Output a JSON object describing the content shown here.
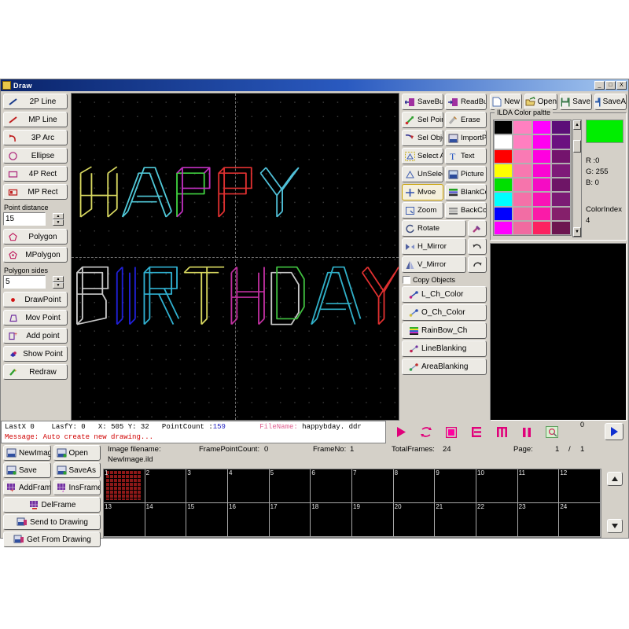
{
  "window": {
    "title": "Draw",
    "icon": "app-icon",
    "minimize": "_",
    "maximize": "□",
    "close": "X"
  },
  "left_tools": {
    "draw_tools": [
      {
        "label": "2P Line",
        "icon": "line-icon"
      },
      {
        "label": "MP Line",
        "icon": "polyline-icon"
      },
      {
        "label": "3P Arc",
        "icon": "arc-icon"
      },
      {
        "label": "Ellipse",
        "icon": "ellipse-icon"
      },
      {
        "label": "4P Rect",
        "icon": "rect-icon"
      },
      {
        "label": "MP Rect",
        "icon": "multi-rect-icon"
      }
    ],
    "point_distance": {
      "label": "Point distance",
      "value": "15"
    },
    "polygon_tools": [
      {
        "label": "Polygon",
        "icon": "polygon-icon"
      },
      {
        "label": "MPolygon",
        "icon": "multi-polygon-icon"
      }
    ],
    "polygon_sides": {
      "label": "Polygon sides",
      "value": "5"
    },
    "point_tools": [
      {
        "label": "DrawPoint",
        "icon": "draw-point-icon"
      },
      {
        "label": "Mov Point",
        "icon": "move-point-icon"
      },
      {
        "label": "Add point",
        "icon": "add-point-icon"
      },
      {
        "label": "Show Point",
        "icon": "show-point-icon"
      },
      {
        "label": "Redraw",
        "icon": "redraw-icon"
      }
    ]
  },
  "operations": {
    "rows": [
      [
        {
          "label": "Sel Point",
          "icon": "select-point-icon"
        },
        {
          "label": "Erase",
          "icon": "eraser-icon"
        }
      ],
      [
        {
          "label": "Sel Object",
          "icon": "select-object-icon"
        },
        {
          "label": "ImportPLT",
          "icon": "import-plt-icon"
        }
      ],
      [
        {
          "label": "Select All",
          "icon": "select-all-icon"
        },
        {
          "label": "Text",
          "icon": "text-icon"
        }
      ],
      [
        {
          "label": "UnSelect",
          "icon": "unselect-icon"
        },
        {
          "label": "Picture",
          "icon": "picture-icon"
        }
      ],
      [
        {
          "label": "Mvoe",
          "icon": "move-icon",
          "selected": true
        },
        {
          "label": "BlankColor",
          "icon": "blank-color-icon"
        }
      ],
      [
        {
          "label": "Zoom",
          "icon": "zoom-icon"
        },
        {
          "label": "BackColor",
          "icon": "back-color-icon"
        }
      ],
      [
        {
          "label": "Rotate",
          "icon": "rotate-icon"
        },
        {
          "label": "",
          "icon": "eyedropper-icon",
          "square": true
        }
      ],
      [
        {
          "label": "H_Mirror",
          "icon": "h-mirror-icon"
        },
        {
          "label": "",
          "icon": "undo-icon",
          "square": true
        }
      ],
      [
        {
          "label": "V_Mirror",
          "icon": "v-mirror-icon"
        },
        {
          "label": "",
          "icon": "redo-icon",
          "square": true
        }
      ]
    ],
    "copy_objects": {
      "label": "Copy Objects",
      "checked": false
    },
    "color_tools": [
      {
        "label": "L_Ch_Color",
        "icon": "line-change-color-icon"
      },
      {
        "label": "O_Ch_Color",
        "icon": "object-change-color-icon"
      },
      {
        "label": "RainBow_Ch",
        "icon": "rainbow-icon"
      },
      {
        "label": "LineBlanking",
        "icon": "line-blanking-icon"
      },
      {
        "label": "AreaBlanking",
        "icon": "area-blanking-icon"
      }
    ],
    "buffer_rows": [
      [
        {
          "label": "SaveBuff",
          "icon": "save-buffer-icon"
        },
        {
          "label": "ReadBuff",
          "icon": "read-buffer-icon"
        }
      ]
    ]
  },
  "file_toolbar": {
    "left_pair": [
      {
        "label": "New",
        "icon": "new-file-icon"
      },
      {
        "label": "Open",
        "icon": "open-folder-icon"
      }
    ],
    "right_pair": [
      {
        "label": "Save",
        "icon": "save-icon"
      },
      {
        "label": "SaveAs",
        "icon": "save-as-icon"
      }
    ]
  },
  "palette": {
    "caption": "ILDA Color paltte",
    "colors": [
      "#000000",
      "#ff80c0",
      "#ff00ff",
      "#5c0f78",
      "#ffffff",
      "#ff7ec0",
      "#ff00f0",
      "#6b1180",
      "#ff0000",
      "#fa7ab4",
      "#ff00e0",
      "#74146d",
      "#ffff00",
      "#f878b0",
      "#fb05d2",
      "#7e1a78",
      "#00e000",
      "#f674ac",
      "#f50cc4",
      "#6e1566",
      "#00ffff",
      "#f471a8",
      "#f914b6",
      "#7b1b74",
      "#0000ff",
      "#f26da4",
      "#fa1ba8",
      "#85206b",
      "#ff00ff",
      "#f06aa0",
      "#fc2260",
      "#6d1550"
    ],
    "scroll_up": "▲",
    "scroll_down": "▼",
    "selected_color": "#00ee00",
    "r_label": "R :0",
    "g_label": "G: 255",
    "b_label": "B: 0",
    "color_index_label": "ColorIndex",
    "color_index_value": "4"
  },
  "status": {
    "last_x_label": "LastX",
    "last_x_value": "0",
    "last_y_label": "LasfY:",
    "last_y_value": "0",
    "x_label": "X:",
    "x_value": "505",
    "y_label": "Y:",
    "y_value": "32",
    "point_count_label": "PointCount :",
    "point_count_value": "159",
    "file_name_label": "FileName:",
    "file_name_value": "happybday. ddr",
    "message_label": "Message:",
    "message_value": "Auto create new drawing..."
  },
  "media": {
    "buttons": [
      {
        "icon": "play-icon"
      },
      {
        "icon": "loop-icon"
      },
      {
        "icon": "stop-icon"
      },
      {
        "icon": "reverse-icon"
      },
      {
        "icon": "step-icon"
      },
      {
        "icon": "pause-icon"
      },
      {
        "icon": "select-area-icon"
      }
    ],
    "counter_value": "0",
    "next_icon": "next-arrow-icon"
  },
  "image_panel": {
    "image_filename_label": "Image filename:",
    "image_filename_value": "NewImage.ild",
    "frame_point_count_label": "FramePointCount:",
    "frame_point_count_value": "0",
    "frame_no_label": "FrameNo:",
    "frame_no_value": "1",
    "total_frames_label": "TotalFrames:",
    "total_frames_value": "24",
    "page_label": "Page:",
    "page_current": "1",
    "page_sep": "/",
    "page_total": "1"
  },
  "image_tools": {
    "rows": [
      [
        {
          "label": "NewImage",
          "icon": "new-image-icon"
        },
        {
          "label": "Open",
          "icon": "open-image-icon"
        }
      ],
      [
        {
          "label": "Save",
          "icon": "save-image-icon"
        },
        {
          "label": "SaveAs",
          "icon": "save-as-image-icon"
        }
      ],
      [
        {
          "label": "AddFrame",
          "icon": "add-frame-icon"
        },
        {
          "label": "InsFrame",
          "icon": "insert-frame-icon"
        }
      ]
    ],
    "full_buttons": [
      {
        "label": "DelFrame",
        "icon": "delete-frame-icon"
      },
      {
        "label": "Send to Drawing",
        "icon": "send-to-drawing-icon"
      },
      {
        "label": "Get From Drawing",
        "icon": "get-from-drawing-icon"
      }
    ]
  },
  "frames": {
    "count": 24,
    "numbers": [
      "1",
      "2",
      "3",
      "4",
      "5",
      "6",
      "7",
      "8",
      "9",
      "10",
      "11",
      "12",
      "13",
      "14",
      "15",
      "16",
      "17",
      "18",
      "19",
      "20",
      "21",
      "22",
      "23",
      "24"
    ],
    "filled": [
      1
    ],
    "scroll_up": "▲",
    "scroll_down": "▼"
  },
  "canvas_art": {
    "line1": "HAPPY",
    "line2": "BIRTHDAY",
    "background": "#000000",
    "grid_color": "#3a3a3a"
  }
}
